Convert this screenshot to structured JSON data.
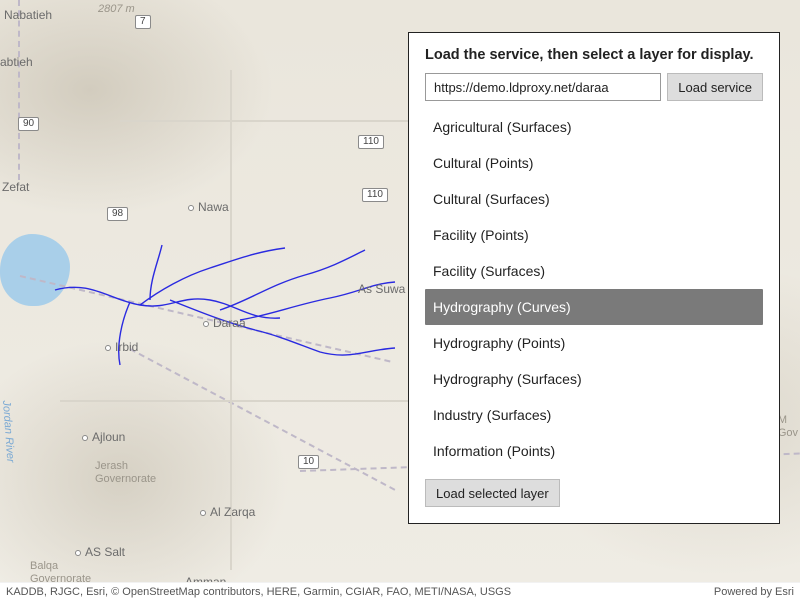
{
  "panel": {
    "heading": "Load the service, then select a layer for display.",
    "url_value": "https://demo.ldproxy.net/daraa",
    "load_service_label": "Load service",
    "load_layer_label": "Load selected layer",
    "layers": [
      "Agricultural (Surfaces)",
      "Cultural (Points)",
      "Cultural (Surfaces)",
      "Facility (Points)",
      "Facility (Surfaces)",
      "Hydrography (Curves)",
      "Hydrography (Points)",
      "Hydrography (Surfaces)",
      "Industry (Surfaces)",
      "Information (Points)"
    ],
    "selected_index": 5
  },
  "map": {
    "shields": {
      "s7": "7",
      "s90": "90",
      "s98": "98",
      "s110a": "110",
      "s110b": "110",
      "s10": "10"
    },
    "towns": {
      "nabatieh": "Nabatieh",
      "abtieh": "abtieh",
      "zefat": "Zefat",
      "nawa": "Nawa",
      "assuwa": "As Suwa",
      "daraa": "Daraa",
      "irbid": "Irbid",
      "ajloun": "Ajloun",
      "alzarqa": "Al Zarqa",
      "assalt": "AS Salt",
      "amman": "Amman"
    },
    "govs": {
      "mgov": "M\nGov",
      "jerash": "Jerash\nGovernorate",
      "balqa": "Balqa\nGovernorate"
    },
    "peak": "2807 m",
    "jriver": "Jordan River"
  },
  "attribution": {
    "left": "KADDB, RJGC, Esri, © OpenStreetMap contributors, HERE, Garmin, CGIAR, FAO, METI/NASA, USGS",
    "right": "Powered by Esri"
  }
}
